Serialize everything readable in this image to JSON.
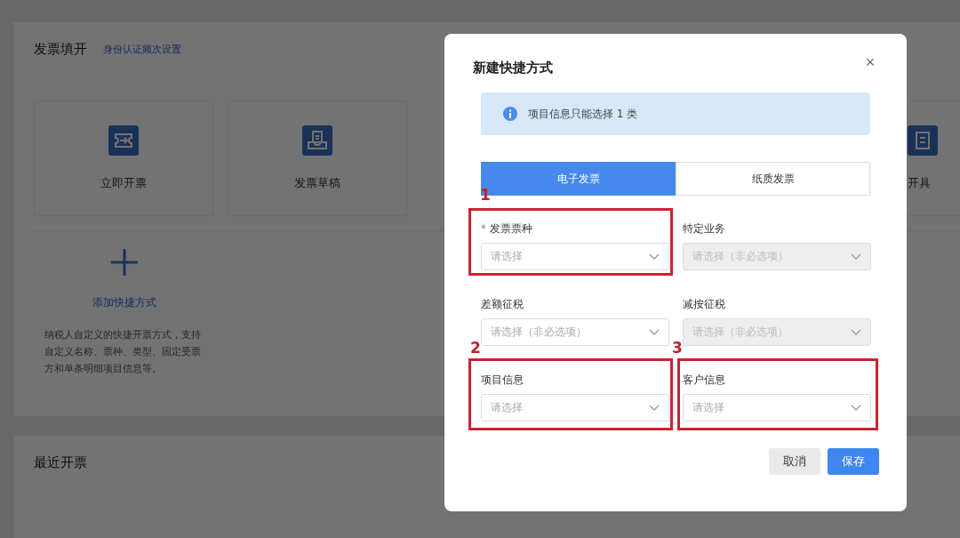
{
  "page": {
    "section_title": "发票填开",
    "settings_link": "身份认证频次设置",
    "shortcuts": [
      {
        "label": "立即开票"
      },
      {
        "label": "发票草稿"
      },
      {
        "label": "开具"
      }
    ],
    "add_shortcut": {
      "label": "添加快捷方式",
      "description": "纳税人自定义的快捷开票方式，支持自定义名称、票种、类型、固定受票方和单条明细项目信息等。"
    },
    "recent_title": "最近开票"
  },
  "dialog": {
    "title": "新建快捷方式",
    "close": "×",
    "alert": "项目信息只能选择 1 类",
    "tabs": [
      {
        "label": "电子发票",
        "selected": true
      },
      {
        "label": "纸质发票",
        "selected": false
      }
    ],
    "fields": [
      {
        "label": "发票票种",
        "required_mark": "*",
        "placeholder": "请选择",
        "disabled": false,
        "annotation": "1"
      },
      {
        "label": "特定业务",
        "placeholder": "请选择（非必选项）",
        "disabled": true
      },
      {
        "label": "差额征税",
        "placeholder": "请选择（非必选项）",
        "disabled": false
      },
      {
        "label": "减按征税",
        "placeholder": "请选择（非必选项）",
        "disabled": true
      },
      {
        "label": "项目信息",
        "placeholder": "请选择",
        "disabled": false,
        "annotation": "2"
      },
      {
        "label": "客户信息",
        "placeholder": "请选择",
        "disabled": false,
        "annotation": "3"
      }
    ],
    "buttons": [
      {
        "label": "取消",
        "kind": "secondary"
      },
      {
        "label": "保存",
        "kind": "primary"
      }
    ]
  }
}
